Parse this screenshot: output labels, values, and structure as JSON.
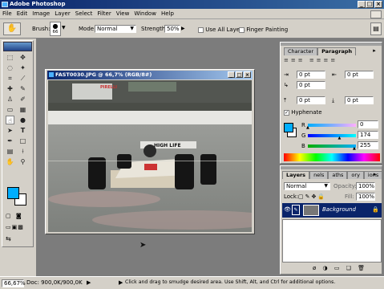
{
  "app": {
    "title": "Adobe Photoshop"
  },
  "menu": [
    "File",
    "Edit",
    "Image",
    "Layer",
    "Select",
    "Filter",
    "View",
    "Window",
    "Help"
  ],
  "options": {
    "brush_label": "Brush:",
    "brush_size": "66",
    "mode_label": "Mode:",
    "mode_value": "Normal",
    "strength_label": "Strength:",
    "strength_value": "50%",
    "use_all_layers": "Use All Layers",
    "finger_painting": "Finger Painting"
  },
  "document": {
    "title": "FAST0030.JPG @ 66,7% (RGB/8#)"
  },
  "photo": {
    "car_sign": "PIRELLI",
    "banner_text": "HIGH LIFE"
  },
  "character_panel": {
    "tabs": [
      "Character",
      "Paragraph"
    ],
    "indent_left": "0 pt",
    "indent_right": "0 pt",
    "first_line": "0 pt",
    "space_before": "0 pt",
    "space_after": "0 pt",
    "hyphenate": "Hyphenate"
  },
  "color_panel": {
    "r_label": "R",
    "g_label": "G",
    "b_label": "B",
    "r_value": "0",
    "g_value": "174",
    "b_value": "255",
    "swatch": "#00aeff",
    "r_fraction": 0.0,
    "g_fraction": 0.68,
    "b_fraction": 1.0
  },
  "layers_panel": {
    "tabs": [
      "Layers",
      "Channels",
      "Paths",
      "History",
      "Actions"
    ],
    "tab_abbrev": [
      "Layers",
      "nels",
      "aths",
      "ory",
      "ions"
    ],
    "blend_mode": "Normal",
    "opacity_label": "Opacity:",
    "opacity_value": "100%",
    "lock_label": "Lock:",
    "fill_label": "Fill:",
    "fill_value": "100%",
    "layer_name": "Background"
  },
  "status": {
    "zoom": "66,67%",
    "doc": "Doc: 900,0K/900,0K",
    "hint": "Click and drag to smudge desired area. Use Shift, Alt, and Ctrl for additional options."
  },
  "colors": {
    "title_start": "#0a246a",
    "title_end": "#3a6ea5",
    "chrome": "#d4d0c8",
    "workspace": "#7c7c7c",
    "foreground": "#00aeff",
    "layer_selected": "#0a246a"
  }
}
